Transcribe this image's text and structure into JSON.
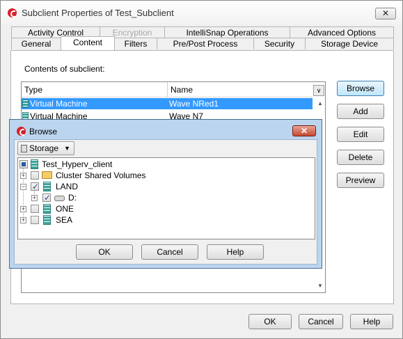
{
  "window": {
    "title": "Subclient Properties of Test_Subclient",
    "close_label": "✕"
  },
  "tabs_row1": [
    "Activity Control",
    "Encryption",
    "IntelliSnap Operations",
    "Advanced Options"
  ],
  "tabs_row2": [
    "General",
    "Content",
    "Filters",
    "Pre/Post Process",
    "Security",
    "Storage Device"
  ],
  "content": {
    "label": "Contents of subclient:",
    "columns": [
      "Type",
      "Name"
    ],
    "rows": [
      {
        "type": "Virtual Machine",
        "name": "Wave NRed1"
      },
      {
        "type": "Virtual Machine",
        "name": "Wave N7"
      }
    ]
  },
  "side_buttons": [
    "Browse",
    "Add",
    "Edit",
    "Delete",
    "Preview"
  ],
  "footer_buttons": [
    "OK",
    "Cancel",
    "Help"
  ],
  "browse_dialog": {
    "title": "Browse",
    "close_label": "✕",
    "storage_label": "Storage",
    "tree": [
      {
        "label": "Test_Hyperv_client"
      },
      {
        "label": "Cluster Shared Volumes"
      },
      {
        "label": "LAND"
      },
      {
        "label": "D:"
      },
      {
        "label": "ONE"
      },
      {
        "label": "SEA"
      }
    ],
    "buttons": [
      "OK",
      "Cancel",
      "Help"
    ]
  }
}
